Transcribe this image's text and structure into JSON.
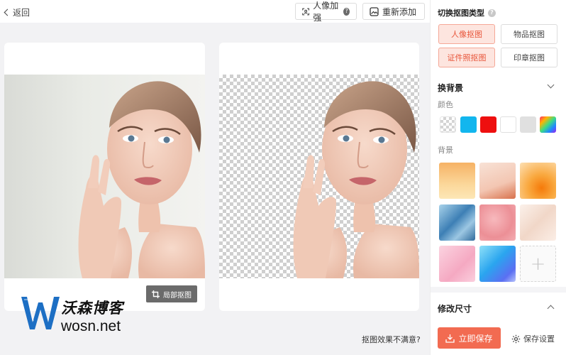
{
  "topbar": {
    "back_label": "返回",
    "enhance_label": "人像加强",
    "enhance_help": "?",
    "readd_label": "重新添加"
  },
  "canvas": {
    "local_cut_label": "局部抠图",
    "unsatisfied_label": "抠图效果不满意?"
  },
  "watermark": {
    "brand_cn": "沃森博客",
    "brand_domain": "wosn.net",
    "logo_letter": "W"
  },
  "panel": {
    "type_title": "切换抠图类型",
    "type_help": "?",
    "types": [
      {
        "label": "人像抠图",
        "active": true
      },
      {
        "label": "物品抠图",
        "active": false
      },
      {
        "label": "证件照抠图",
        "active": true
      },
      {
        "label": "印章抠图",
        "active": false
      }
    ],
    "background_title": "换背景",
    "color_label": "颜色",
    "colors": [
      {
        "name": "transparent",
        "hex": "transparent"
      },
      {
        "name": "sky-blue",
        "hex": "#12b6ee"
      },
      {
        "name": "red",
        "hex": "#ee0f0f"
      },
      {
        "name": "white",
        "hex": "#ffffff"
      },
      {
        "name": "light-gray",
        "hex": "#e0e0e0"
      },
      {
        "name": "rainbow",
        "hex": "gradient"
      }
    ],
    "bg_label": "背景",
    "bg_add_symbol": "+",
    "resize_title": "修改尺寸",
    "save_label": "立即保存",
    "save_settings_label": "保存设置"
  },
  "accent_color": "#f26b51"
}
